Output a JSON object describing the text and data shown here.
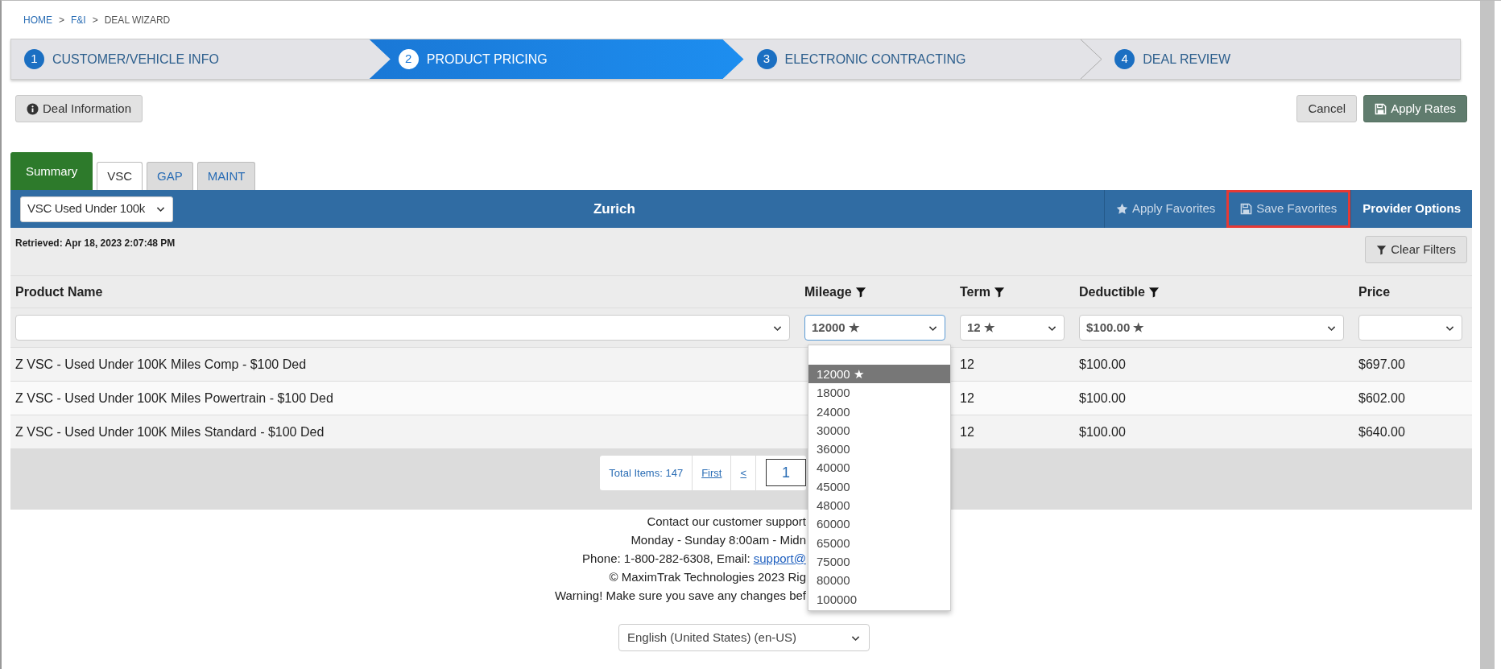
{
  "breadcrumb": [
    {
      "label": "HOME",
      "kind": "link"
    },
    {
      "label": "F&I",
      "kind": "link"
    },
    {
      "label": "DEAL WIZARD",
      "kind": "current"
    }
  ],
  "breadcrumb_separator": ">",
  "steps": [
    {
      "number": "1",
      "label": "CUSTOMER/VEHICLE INFO",
      "selected": false
    },
    {
      "number": "2",
      "label": "PRODUCT PRICING",
      "selected": true
    },
    {
      "number": "3",
      "label": "ELECTRONIC CONTRACTING",
      "selected": false
    },
    {
      "number": "4",
      "label": "DEAL REVIEW",
      "selected": false
    }
  ],
  "toolbar": {
    "deal_info": "Deal Information",
    "cancel": "Cancel",
    "apply_rates": "Apply Rates"
  },
  "tabs": [
    {
      "label": "Summary",
      "kind": "summary",
      "selected": false
    },
    {
      "label": "VSC",
      "kind": "product",
      "selected": true
    },
    {
      "label": "GAP",
      "kind": "product",
      "selected": false
    },
    {
      "label": "MAINT",
      "kind": "product",
      "selected": false
    }
  ],
  "provider_bar": {
    "program": "VSC Used Under 100k",
    "provider": "Zurich",
    "actions": [
      {
        "label": "Apply Favorites",
        "kind": "star",
        "highlighted": false
      },
      {
        "label": "Save Favorites",
        "kind": "save",
        "highlighted": true
      },
      {
        "label": "Provider Options",
        "kind": "plain",
        "highlighted": false
      }
    ]
  },
  "retrieved": "Retrieved: Apr 18, 2023 2:07:48 PM",
  "clear_filters": "Clear Filters",
  "table": {
    "columns": [
      {
        "label": "Product Name",
        "filterable": false,
        "focused": false
      },
      {
        "label": "Mileage",
        "filterable": true,
        "filter_value": "12000 ★",
        "focused": true
      },
      {
        "label": "Term",
        "filterable": true,
        "filter_value": "12 ★",
        "focused": false
      },
      {
        "label": "Deductible",
        "filterable": true,
        "filter_value": "$100.00 ★",
        "focused": false
      },
      {
        "label": "Price",
        "filterable": false,
        "focused": false
      }
    ],
    "rows": [
      [
        "Z VSC - Used Under 100K Miles Comp - $100 Ded",
        "",
        "12",
        "$100.00",
        "$697.00"
      ],
      [
        "Z VSC - Used Under 100K Miles Powertrain - $100 Ded",
        "",
        "12",
        "$100.00",
        "$602.00"
      ],
      [
        "Z VSC - Used Under 100K Miles Standard - $100 Ded",
        "",
        "12",
        "$100.00",
        "$640.00"
      ]
    ]
  },
  "mileage_dropdown": [
    {
      "label": "12000 ★",
      "selected": true
    },
    {
      "label": "18000",
      "selected": false
    },
    {
      "label": "24000",
      "selected": false
    },
    {
      "label": "30000",
      "selected": false
    },
    {
      "label": "36000",
      "selected": false
    },
    {
      "label": "40000",
      "selected": false
    },
    {
      "label": "45000",
      "selected": false
    },
    {
      "label": "48000",
      "selected": false
    },
    {
      "label": "60000",
      "selected": false
    },
    {
      "label": "65000",
      "selected": false
    },
    {
      "label": "75000",
      "selected": false
    },
    {
      "label": "80000",
      "selected": false
    },
    {
      "label": "100000",
      "selected": false
    }
  ],
  "pager": {
    "total": "Total Items: 147",
    "first": "First",
    "prev": "<",
    "page": "1"
  },
  "footer": [
    {
      "text": "Contact our customer support"
    },
    {
      "text": "Monday - Sunday 8:00am - Midn"
    },
    {
      "text": "Phone: 1-800-282-6308, Email: ",
      "link": "support@"
    },
    {
      "text": "© MaximTrak Technologies 2023 Rig"
    },
    {
      "text": "Warning! Make sure you save any changes bef"
    }
  ],
  "language": "English (United States) (en-US)"
}
